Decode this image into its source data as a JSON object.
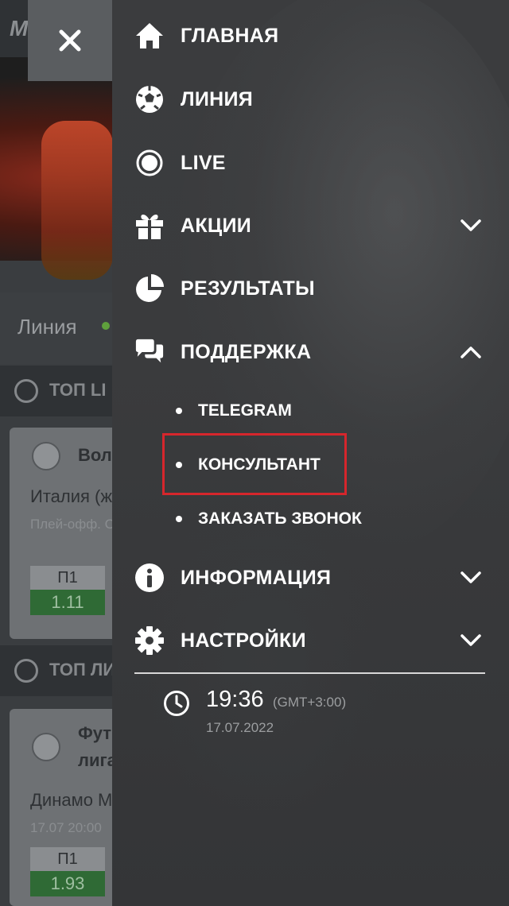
{
  "background": {
    "logo": "M",
    "tab_label": "Линия",
    "section1_label": "ТОП LI",
    "section2_label": "ТОП ЛИ",
    "card1": {
      "sport": "Воле",
      "team": "Италия (ж",
      "sub": "Плей-офф. С",
      "odd_label": "П1",
      "odd_value": "1.11"
    },
    "card2": {
      "sport_line1": "Футб",
      "sport_line2": "лига",
      "team": "Динамо М",
      "sub": "17.07  20:00",
      "odd_label": "П1",
      "odd_value": "1.93"
    }
  },
  "close_icon": "close-icon",
  "menu": {
    "items": [
      {
        "label": "ГЛАВНАЯ",
        "icon": "home-icon"
      },
      {
        "label": "ЛИНИЯ",
        "icon": "soccer-ball-icon"
      },
      {
        "label": "LIVE",
        "icon": "live-icon"
      },
      {
        "label": "АКЦИИ",
        "icon": "gift-icon",
        "expandable": true,
        "expanded": false
      },
      {
        "label": "РЕЗУЛЬТАТЫ",
        "icon": "pie-chart-icon"
      },
      {
        "label": "ПОДДЕРЖКА",
        "icon": "chat-icon",
        "expandable": true,
        "expanded": true
      },
      {
        "label": "ИНФОРМАЦИЯ",
        "icon": "info-icon",
        "expandable": true,
        "expanded": false
      },
      {
        "label": "НАСТРОЙКИ",
        "icon": "gear-icon",
        "expandable": true,
        "expanded": false
      }
    ],
    "support_subitems": [
      {
        "label": "TELEGRAM"
      },
      {
        "label": "КОНСУЛЬТАНТ",
        "highlighted": true
      },
      {
        "label": "ЗАКАЗАТЬ ЗВОНОК"
      }
    ]
  },
  "clock": {
    "time": "19:36",
    "timezone": "(GMT+3:00)",
    "date": "17.07.2022"
  },
  "colors": {
    "highlight": "#d6262c",
    "text": "#ffffff",
    "muted": "#9c9ea0"
  }
}
